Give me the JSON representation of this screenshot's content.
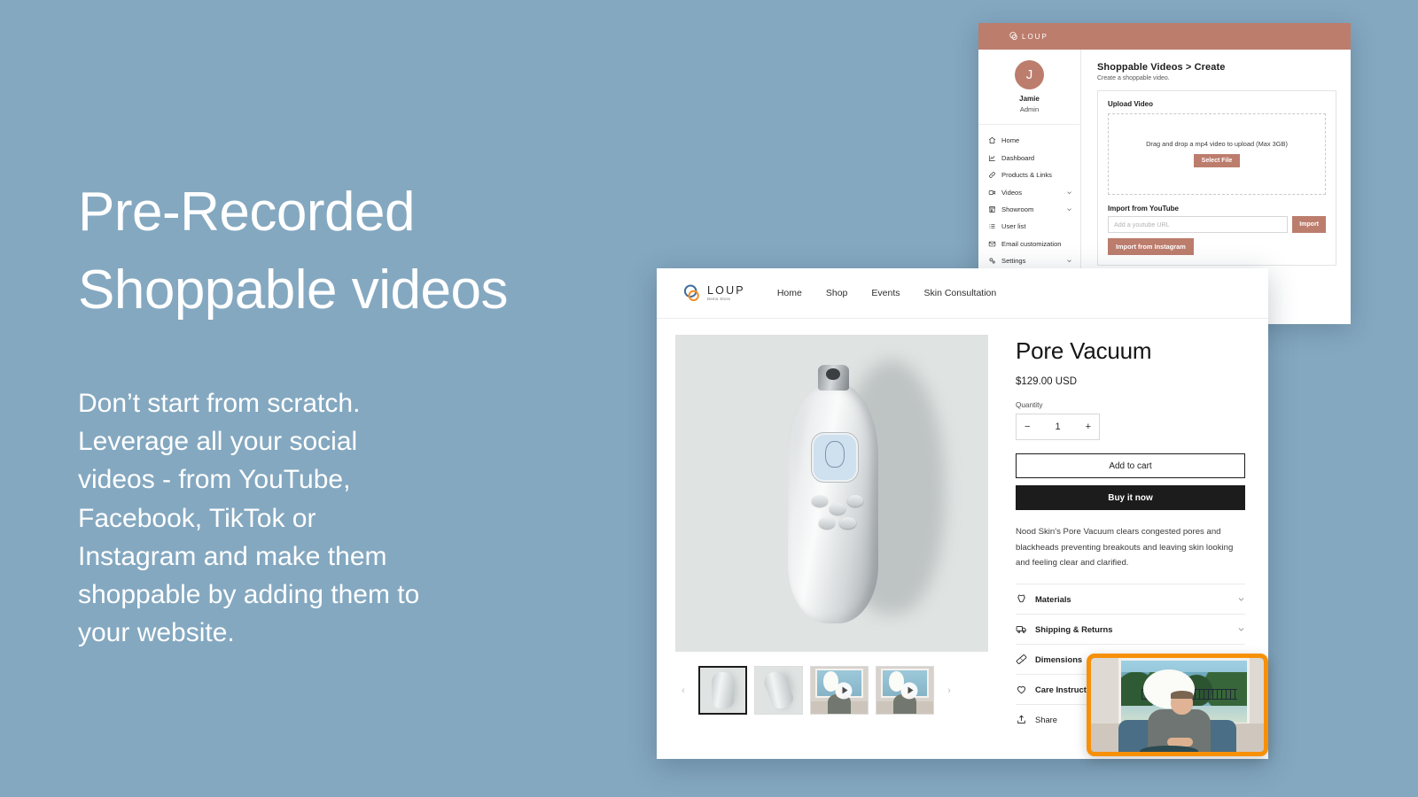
{
  "theme": {
    "background": "#84a8c0",
    "admin_accent": "#bc7d6d",
    "highlight_orange": "#f79009",
    "logo_blue": "#3f6f9e",
    "logo_orange": "#f2912b"
  },
  "hero": {
    "heading": "Pre-Recorded\nShoppable videos",
    "body": "Don’t start from scratch. Leverage all your social videos - from YouTube, Facebook, TikTok or Instagram and make them shoppable by adding them to your website."
  },
  "admin": {
    "brand": "LOUP",
    "user": {
      "initial": "J",
      "name": "Jamie",
      "role": "Admin"
    },
    "nav": [
      {
        "label": "Home",
        "icon": "home-icon",
        "expandable": false
      },
      {
        "label": "Dashboard",
        "icon": "chart-icon",
        "expandable": false
      },
      {
        "label": "Products & Links",
        "icon": "link-icon",
        "expandable": false
      },
      {
        "label": "Videos",
        "icon": "video-camera-icon",
        "expandable": true
      },
      {
        "label": "Showroom",
        "icon": "store-icon",
        "expandable": true
      },
      {
        "label": "User list",
        "icon": "list-icon",
        "expandable": false
      },
      {
        "label": "Email customization",
        "icon": "mail-icon",
        "expandable": false
      },
      {
        "label": "Settings",
        "icon": "gears-icon",
        "expandable": true
      }
    ],
    "page": {
      "title": "Shoppable Videos > Create",
      "subtitle": "Create a shoppable video.",
      "upload_label": "Upload Video",
      "dropzone_text": "Drag and drop a mp4 video to upload (Max 3GB)",
      "select_file_label": "Select File",
      "youtube_label": "Import from YouTube",
      "youtube_placeholder": "Add a youtube URL",
      "youtube_value": "",
      "import_label": "Import",
      "instagram_label": "Import from Instagram"
    }
  },
  "store": {
    "logo": {
      "wordmark": "LOUP",
      "tagline": "Demo Store"
    },
    "nav": [
      "Home",
      "Shop",
      "Events",
      "Skin Consultation"
    ],
    "gallery": {
      "prev_label": "‹",
      "next_label": "›",
      "thumbnails": [
        {
          "type": "image",
          "alt": "Pore Vacuum front view",
          "active": true
        },
        {
          "type": "image",
          "alt": "Pore Vacuum angled view",
          "active": false
        },
        {
          "type": "video",
          "alt": "Creator demo video 1",
          "active": false
        },
        {
          "type": "video",
          "alt": "Creator demo video 2",
          "active": false
        }
      ]
    },
    "product": {
      "title": "Pore Vacuum",
      "price": "$129.00 USD",
      "quantity_label": "Quantity",
      "quantity_value": "1",
      "decrement_label": "−",
      "increment_label": "+",
      "add_to_cart_label": "Add to cart",
      "buy_now_label": "Buy it now",
      "description": "Nood Skin's Pore Vacuum clears congested pores and blackheads preventing breakouts and leaving skin looking and feeling clear and clarified.",
      "accordions": [
        {
          "label": "Materials",
          "icon": "fabric-icon",
          "chevron": true
        },
        {
          "label": "Shipping & Returns",
          "icon": "truck-icon",
          "chevron": true
        },
        {
          "label": "Dimensions",
          "icon": "ruler-icon",
          "chevron": true
        },
        {
          "label": "Care Instructions",
          "icon": "heart-icon",
          "chevron": true
        },
        {
          "label": "Share",
          "icon": "share-icon",
          "chevron": false
        }
      ]
    }
  },
  "video_overlay": {
    "alt": "Creator holding the Pore Vacuum in a sunlit room",
    "border_color": "#f79009"
  }
}
